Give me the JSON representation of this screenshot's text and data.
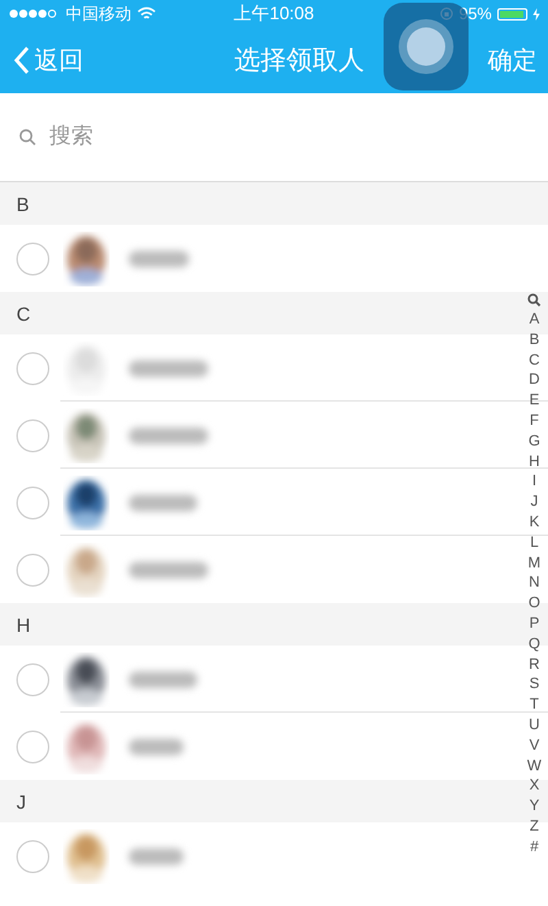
{
  "status_bar": {
    "carrier": "中国移动",
    "time": "上午10:08",
    "battery_text": "95%"
  },
  "nav": {
    "back": "返回",
    "title": "选择领取人",
    "confirm": "确定"
  },
  "search": {
    "placeholder": "搜索"
  },
  "sections": [
    {
      "letter": "B",
      "contacts": [
        {
          "selected": false
        }
      ]
    },
    {
      "letter": "C",
      "contacts": [
        {
          "selected": false
        },
        {
          "selected": false
        },
        {
          "selected": false
        },
        {
          "selected": false
        }
      ]
    },
    {
      "letter": "H",
      "contacts": [
        {
          "selected": false
        },
        {
          "selected": false
        }
      ]
    },
    {
      "letter": "J",
      "contacts": [
        {
          "selected": false
        }
      ]
    }
  ],
  "index": [
    "A",
    "B",
    "C",
    "D",
    "E",
    "F",
    "G",
    "H",
    "I",
    "J",
    "K",
    "L",
    "M",
    "N",
    "O",
    "P",
    "Q",
    "R",
    "S",
    "T",
    "U",
    "V",
    "W",
    "X",
    "Y",
    "Z",
    "#"
  ]
}
